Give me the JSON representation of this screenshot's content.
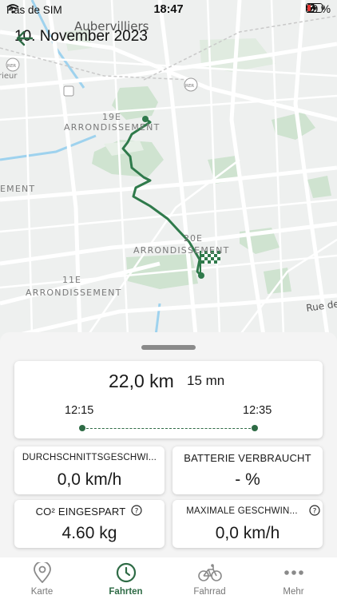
{
  "status_bar": {
    "carrier": "Pas de SIM",
    "time": "18:47",
    "battery": "19 %",
    "icons": [
      "wifi-icon",
      "location-arrow-icon",
      "rotation-lock-icon",
      "battery-charging-icon"
    ]
  },
  "header": {
    "title": "10. November 2023",
    "back_icon": "arrow-left-icon"
  },
  "map": {
    "labels": {
      "city": "Aubervilliers",
      "rer1": "RER",
      "rer2": "RER",
      "rer3": "RER",
      "frag_rieur": "rieur",
      "arr19_num": "19E",
      "arr19": "ARRONDISSEMENT",
      "frag_ement": "EMENT",
      "arr20_num": "20E",
      "arr20": "ARRONDISSEMENT",
      "arr11_num": "11E",
      "arr11": "ARRONDISSEMENT",
      "street": "Rue de"
    }
  },
  "trip": {
    "distance": "22,0 km",
    "duration": "15 mn",
    "start_time": "12:15",
    "end_time": "12:35"
  },
  "stats": {
    "avg_speed": {
      "label": "DURCHSCHNITTSGESCHWI...",
      "value": "0,0 km/h"
    },
    "battery_used": {
      "label": "BATTERIE VERBRAUCHT",
      "value": "- %"
    },
    "co2_saved": {
      "label": "CO² EINGESPART",
      "value": "4.60 kg"
    },
    "max_speed": {
      "label": "MAXIMALE GESCHWIN...",
      "value": "0,0 km/h"
    }
  },
  "tabs": [
    {
      "label": "Karte",
      "icon": "map-pin-icon"
    },
    {
      "label": "Fahrten",
      "icon": "clock-icon",
      "active": true
    },
    {
      "label": "Fahrrad",
      "icon": "bicycle-icon"
    },
    {
      "label": "Mehr",
      "icon": "more-dots-icon"
    }
  ],
  "colors": {
    "accent": "#2e6b45",
    "route": "#2f7a4b",
    "park": "#cfe3d0"
  }
}
